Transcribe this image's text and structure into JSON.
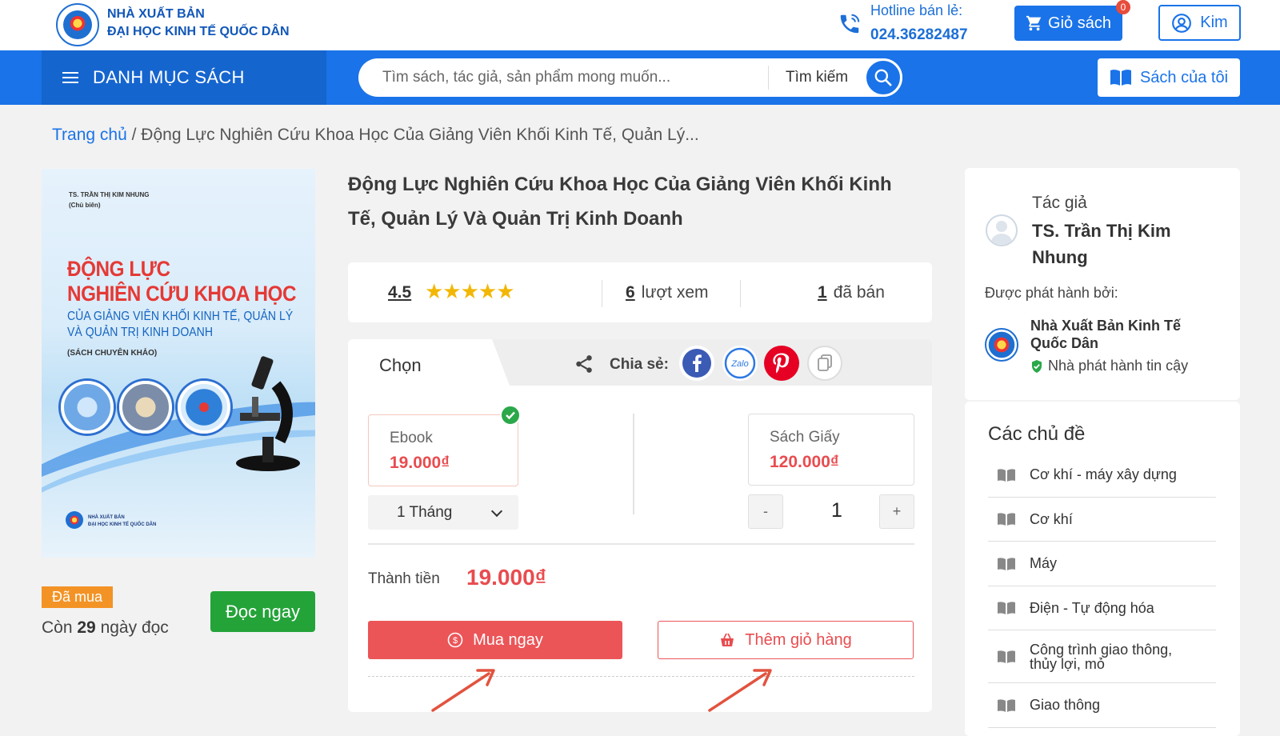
{
  "header": {
    "publisher_line1": "NHÀ XUẤT BẢN",
    "publisher_line2": "ĐẠI HỌC KINH TẾ QUỐC DÂN",
    "hotline_label": "Hotline bán lẻ:",
    "hotline_number": "024.36282487",
    "cart_label": "Giỏ sách",
    "cart_count": "0",
    "user_label": "Kim"
  },
  "nav": {
    "menu_label": "DANH MỤC SÁCH",
    "search_placeholder": "Tìm sách, tác giả, sản phẩm mong muốn...",
    "search_button": "Tìm kiếm",
    "my_books": "Sách của tôi"
  },
  "breadcrumb": {
    "home": "Trang chủ",
    "current": "/ Động Lực Nghiên Cứu Khoa Học Của Giảng Viên Khối Kinh Tế, Quản Lý..."
  },
  "cover": {
    "author_line1": "TS. TRẦN THỊ KIM NHUNG",
    "author_line2": "(Chủ biên)",
    "title_line1": "ĐỘNG LỰC",
    "title_line2": "NGHIÊN CỨU KHOA HỌC",
    "subtitle_line1": "CỦA GIẢNG VIÊN KHỐI KINH TẾ, QUẢN LÝ",
    "subtitle_line2": "VÀ QUẢN TRỊ KINH DOANH",
    "kind": "(SÁCH CHUYÊN KHẢO)",
    "footer_line1": "NHÀ XUẤT BẢN",
    "footer_line2": "ĐẠI HỌC KINH TẾ QUỐC DÂN"
  },
  "purchase": {
    "bought_tag": "Đã mua",
    "days_prefix": "Còn",
    "days_value": "29",
    "days_suffix": "ngày đọc",
    "read_button": "Đọc ngay"
  },
  "book": {
    "title": "Động Lực Nghiên Cứu Khoa Học Của Giảng Viên Khối Kinh Tế, Quản Lý Và Quản Trị Kinh Doanh",
    "rating": "4.5",
    "stars": "★★★★★",
    "views_count": "6",
    "views_label": "lượt xem",
    "sold_count": "1",
    "sold_label": "đã bán"
  },
  "options": {
    "tab_label": "Chọn",
    "share_label": "Chia sẻ:",
    "zalo_label": "Zalo",
    "ebook_name": "Ebook",
    "ebook_price": "19.000₫",
    "paper_name": "Sách Giấy",
    "paper_price": "120.000₫",
    "duration": "1 Tháng",
    "qty_minus": "-",
    "qty_value": "1",
    "qty_plus": "+",
    "total_label": "Thành tiền",
    "total_value": "19.000₫",
    "buy_now": "Mua ngay",
    "add_to_cart": "Thêm giỏ hàng"
  },
  "sidebar": {
    "author_label": "Tác giả",
    "author_name": "TS. Trần Thị Kim Nhung",
    "issued_by_label": "Được phát hành bởi:",
    "publisher_name": "Nhà Xuất Bản Kinh Tế Quốc Dân",
    "trusted_label": "Nhà phát hành tin cậy",
    "topics_title": "Các chủ đề",
    "topics": [
      "Cơ khí - máy xây dựng",
      "Cơ khí",
      "Máy",
      "Điện - Tự động hóa",
      "Công trình giao thông, thủy lợi, mỏ",
      "Giao thông"
    ]
  },
  "colors": {
    "primary_blue": "#1a73e8",
    "price_red": "#e84c4f",
    "read_green": "#24a339",
    "bought_orange": "#f39325"
  }
}
